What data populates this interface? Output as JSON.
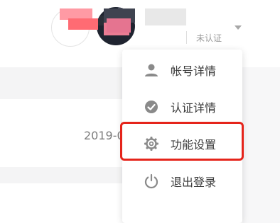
{
  "header": {
    "account_label": "",
    "status_label": "未认证"
  },
  "content": {
    "date_text": "2019-0"
  },
  "dropdown": {
    "items": [
      {
        "label": "帐号详情",
        "icon": "user-icon"
      },
      {
        "label": "认证详情",
        "icon": "check-circle-icon"
      },
      {
        "label": "功能设置",
        "icon": "gear-icon"
      },
      {
        "label": "退出登录",
        "icon": "power-icon"
      }
    ],
    "highlighted_item": "功能设置"
  },
  "colors": {
    "highlight": "#e5241b",
    "icon": "#8a8a8a",
    "text": "#3a3a3a"
  }
}
